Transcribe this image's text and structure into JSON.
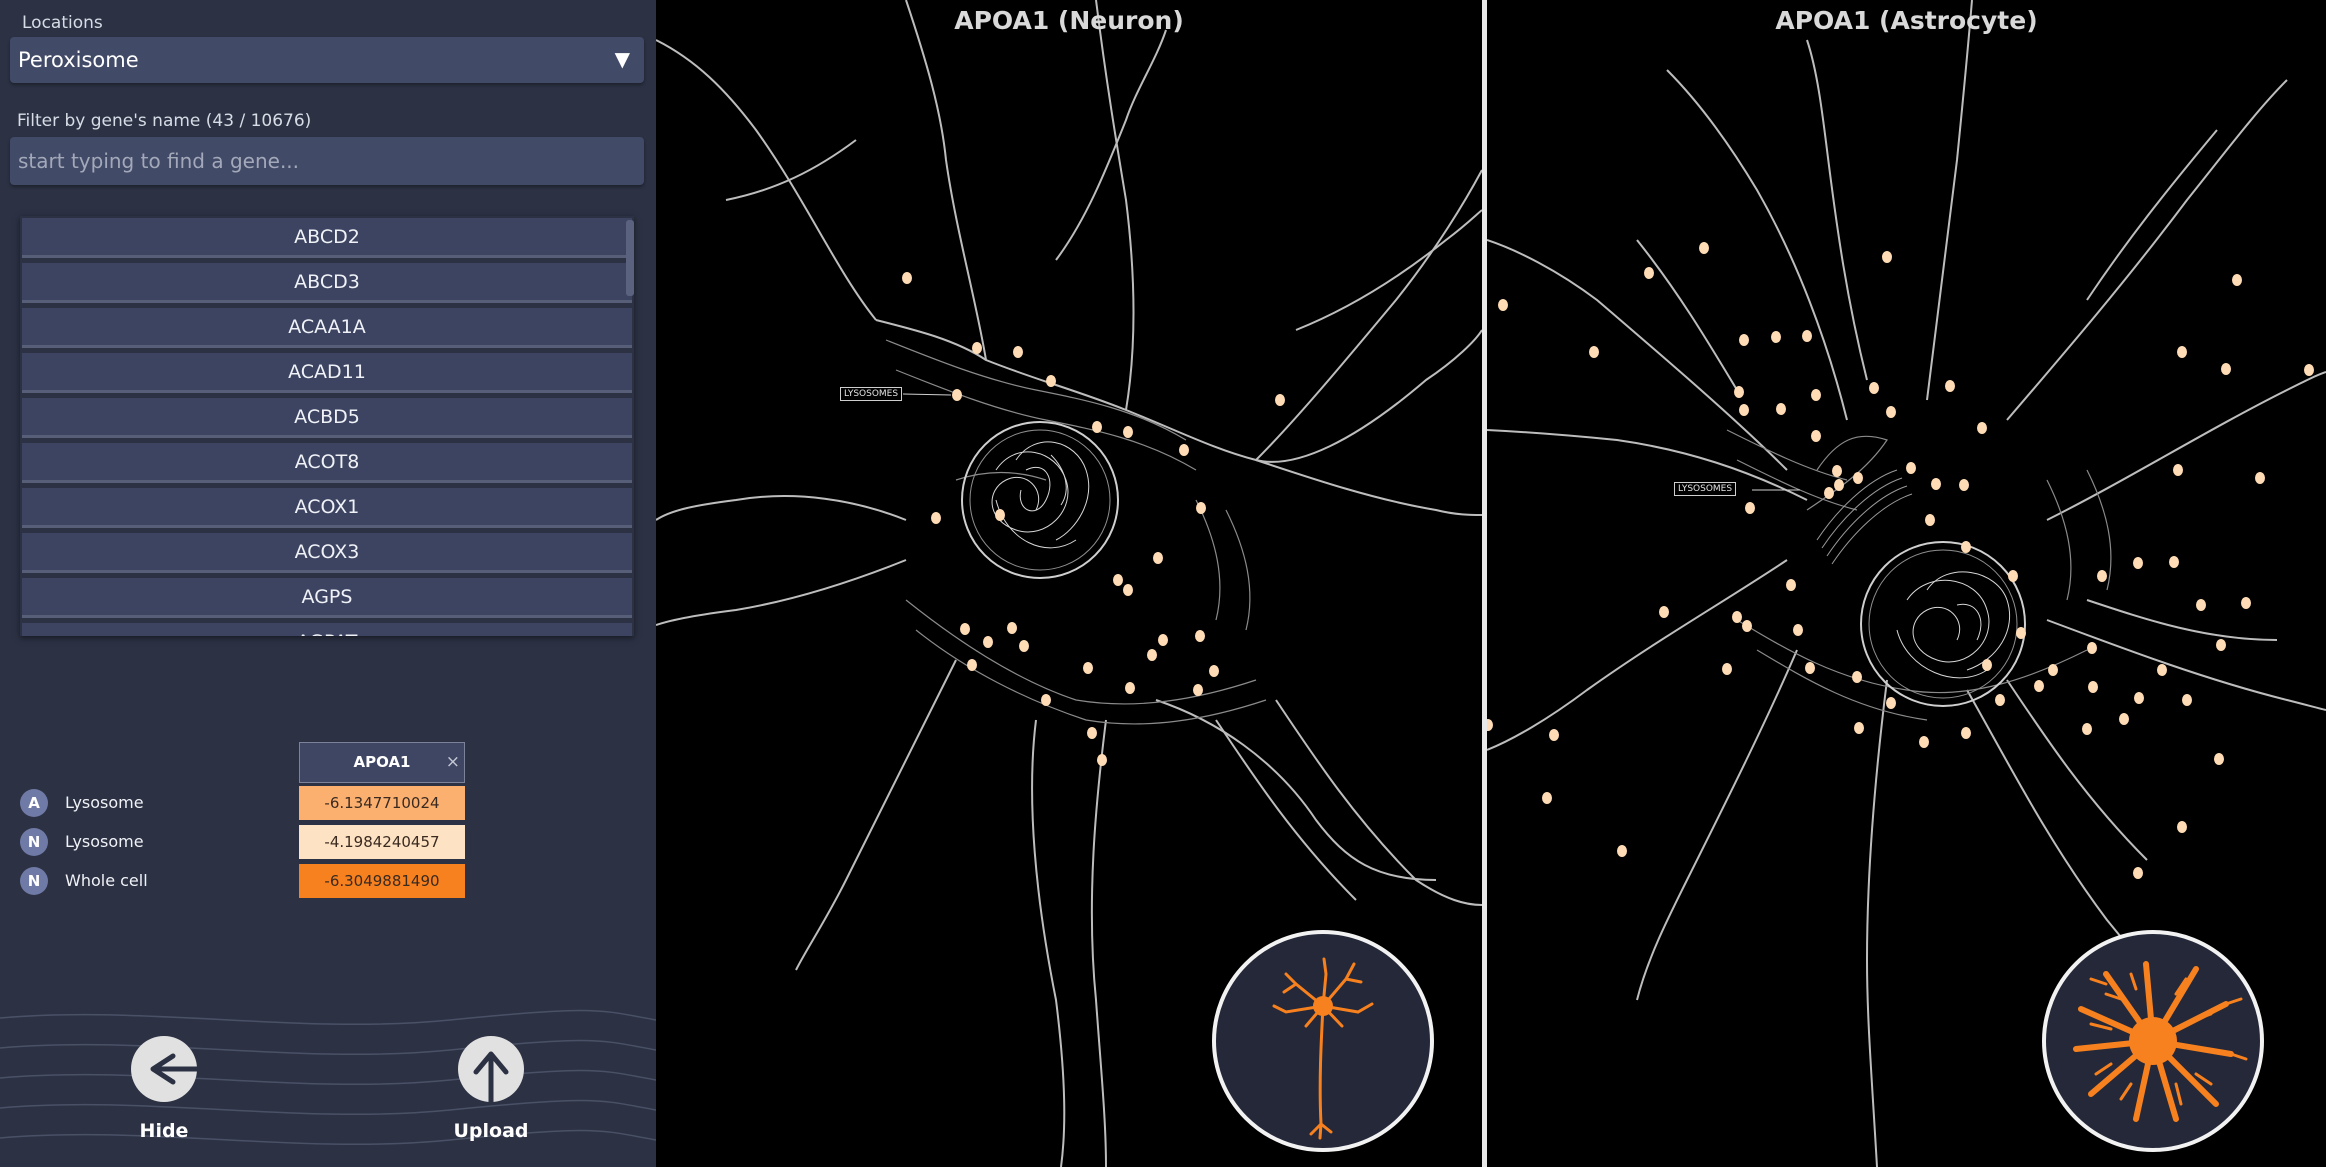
{
  "sidebar": {
    "locations_label": "Locations",
    "location_value": "Peroxisome",
    "filter_label": "Filter by gene's name (43 / 10676)",
    "search_placeholder": "start typing to find a gene...",
    "genes": [
      "ABCD2",
      "ABCD3",
      "ACAA1A",
      "ACAD11",
      "ACBD5",
      "ACOT8",
      "ACOX1",
      "ACOX3",
      "AGPS",
      "AGPAT"
    ],
    "results": {
      "gene": "APOA1",
      "close_glyph": "×",
      "rows": [
        {
          "badge": "A",
          "label": "Lysosome",
          "value": "-6.1347710024",
          "color": "#fcb06f"
        },
        {
          "badge": "N",
          "label": "Lysosome",
          "value": "-4.1984240457",
          "color": "#fde2c4"
        },
        {
          "badge": "N",
          "label": "Whole cell",
          "value": "-6.3049881490",
          "color": "#f7811e"
        }
      ]
    },
    "actions": {
      "hide_label": "Hide",
      "upload_label": "Upload"
    }
  },
  "panels": [
    {
      "title": "APOA1 (Neuron)",
      "organelle_label": "LYSOSOMES",
      "cell_icon": "neuron-icon"
    },
    {
      "title": "APOA1 (Astrocyte)",
      "organelle_label": "LYSOSOMES",
      "cell_icon": "astrocyte-icon"
    }
  ],
  "colors": {
    "sidebar_bg": "#2c3244",
    "accent_orange": "#f7811e",
    "lysosome_dot": "#ffdcb5",
    "cell_outline": "#bdbdbd"
  }
}
